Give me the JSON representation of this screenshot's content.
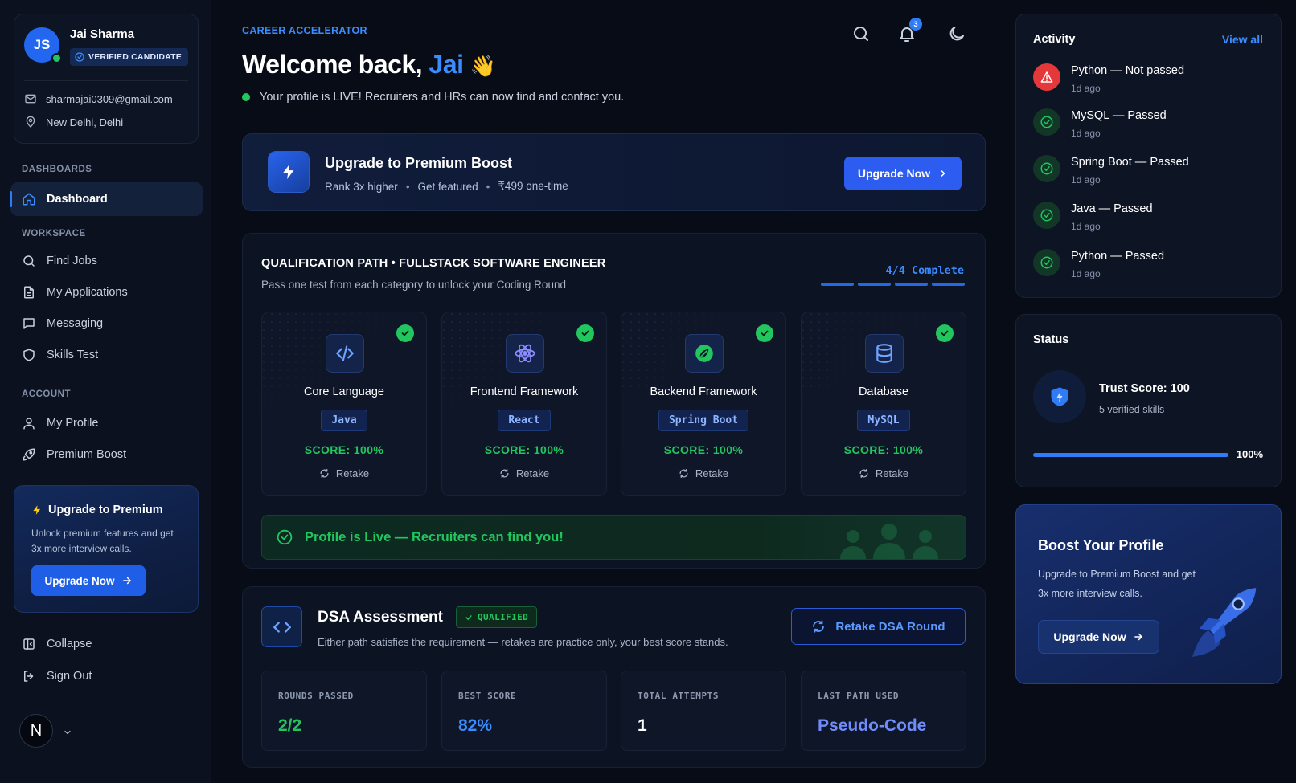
{
  "sidebar": {
    "user": {
      "initials": "JS",
      "name": "Jai Sharma",
      "badge": "VERIFIED CANDIDATE",
      "email": "sharmajai0309@gmail.com",
      "location": "New Delhi, Delhi"
    },
    "sections": {
      "dashboards": "DASHBOARDS",
      "workspace": "WORKSPACE",
      "account": "ACCOUNT"
    },
    "nav": {
      "dashboard": "Dashboard",
      "find_jobs": "Find Jobs",
      "my_applications": "My Applications",
      "messaging": "Messaging",
      "skills_test": "Skills Test",
      "my_profile": "My Profile",
      "premium_boost": "Premium Boost",
      "collapse": "Collapse",
      "sign_out": "Sign Out"
    },
    "upgrade": {
      "title": "Upgrade to Premium",
      "description": "Unlock premium features and get 3x more interview calls.",
      "button": "Upgrade Now"
    },
    "footer_avatar": "N"
  },
  "header": {
    "eyebrow": "CAREER ACCELERATOR",
    "welcome_prefix": "Welcome back, ",
    "welcome_name": "Jai",
    "welcome_emoji": "👋",
    "live_message": "Your profile is LIVE! Recruiters and HRs can now find and contact you.",
    "notification_count": "3"
  },
  "premium_banner": {
    "title": "Upgrade to Premium Boost",
    "perks": [
      "Rank 3x higher",
      "Get featured",
      "₹499 one-time"
    ],
    "separator": "•",
    "button": "Upgrade Now"
  },
  "qualification": {
    "title": "QUALIFICATION PATH • FULLSTACK SOFTWARE ENGINEER",
    "subtitle": "Pass one test from each category to unlock your Coding Round",
    "progress_label": "4/4 Complete",
    "progress": {
      "completed": 4,
      "total": 4
    },
    "cards": [
      {
        "category": "Core Language",
        "tech": "Java",
        "score": "SCORE: 100%",
        "retake": "Retake",
        "icon": "code-icon"
      },
      {
        "category": "Frontend Framework",
        "tech": "React",
        "score": "SCORE: 100%",
        "retake": "Retake",
        "icon": "react-icon"
      },
      {
        "category": "Backend Framework",
        "tech": "Spring Boot",
        "score": "SCORE: 100%",
        "retake": "Retake",
        "icon": "spring-leaf-icon"
      },
      {
        "category": "Database",
        "tech": "MySQL",
        "score": "SCORE: 100%",
        "retake": "Retake",
        "icon": "database-icon"
      }
    ],
    "live_banner": "Profile is Live — Recruiters can find you!"
  },
  "dsa": {
    "title": "DSA Assessment",
    "badge": "QUALIFIED",
    "subtitle": "Either path satisfies the requirement — retakes are practice only, your best score stands.",
    "button": "Retake DSA Round",
    "stats": [
      {
        "label": "ROUNDS PASSED",
        "value": "2/2",
        "color": "#22c55e"
      },
      {
        "label": "BEST SCORE",
        "value": "82%",
        "color": "#3b8cff"
      },
      {
        "label": "TOTAL ATTEMPTS",
        "value": "1",
        "color": "#ffffff"
      },
      {
        "label": "LAST PATH USED",
        "value": "Pseudo-Code",
        "color": "#6f8cff"
      }
    ]
  },
  "activity": {
    "title": "Activity",
    "view_all": "View all",
    "items": [
      {
        "label": "Python — Not passed",
        "time": "1d ago",
        "status": "fail"
      },
      {
        "label": "MySQL — Passed",
        "time": "1d ago",
        "status": "pass"
      },
      {
        "label": "Spring Boot — Passed",
        "time": "1d ago",
        "status": "pass"
      },
      {
        "label": "Java — Passed",
        "time": "1d ago",
        "status": "pass"
      },
      {
        "label": "Python — Passed",
        "time": "1d ago",
        "status": "pass"
      }
    ]
  },
  "status": {
    "title": "Status",
    "trust_title": "Trust Score: 100",
    "trust_sub": "5 verified skills",
    "trust_percent": "100%",
    "trust_fraction": 1.0
  },
  "boost_profile": {
    "title": "Boost Your Profile",
    "description": "Upgrade to Premium Boost and get 3x more interview calls.",
    "button": "Upgrade Now"
  },
  "colors": {
    "accent": "#3b8cff",
    "success": "#22c55e",
    "danger": "#e5383b",
    "background": "#080c16"
  }
}
